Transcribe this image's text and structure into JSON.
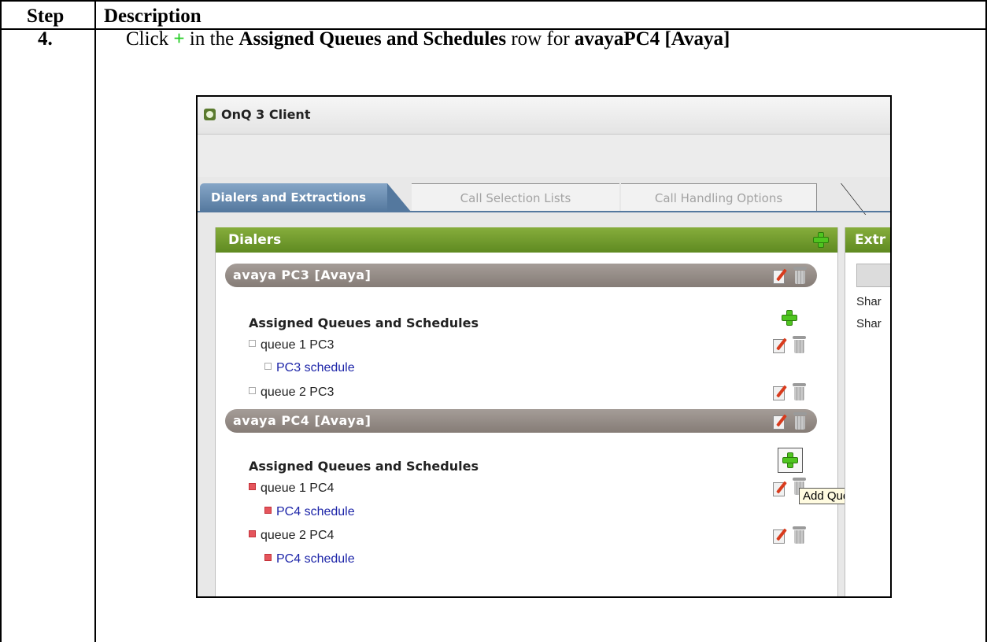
{
  "table": {
    "header_step": "Step",
    "header_description": "Description",
    "step_number": "4.",
    "instruction": {
      "pre": "Click ",
      "plus": "+",
      "mid": " in the ",
      "bold1": "Assigned Queues and Schedules",
      "mid2": " row for ",
      "bold2": "avayaPC4 [Avaya]"
    }
  },
  "window": {
    "title": "OnQ 3 Client"
  },
  "tabs": [
    {
      "label": "Dialers and Extractions",
      "active": true
    },
    {
      "label": "Call Selection Lists",
      "active": false
    },
    {
      "label": "Call Handling Options",
      "active": false
    }
  ],
  "dialers_panel": {
    "title": "Dialers",
    "dialers": [
      {
        "name": "avaya PC3 [Avaya]",
        "section_title": "Assigned Queues and Schedules",
        "queues": [
          {
            "label": "queue 1 PC3",
            "schedule": "PC3 schedule"
          },
          {
            "label": "queue 2 PC3",
            "schedule": ""
          }
        ]
      },
      {
        "name": "avaya PC4 [Avaya]",
        "section_title": "Assigned Queues and Schedules",
        "queues": [
          {
            "label": "queue 1 PC4",
            "schedule": "PC4 schedule"
          },
          {
            "label": "queue 2 PC4",
            "schedule": "PC4 schedule"
          }
        ]
      }
    ],
    "tooltip": "Add Queue"
  },
  "extractions_panel": {
    "title_partial": "Extr",
    "rows": [
      "Shar",
      "Shar"
    ]
  },
  "colors": {
    "panel_header": "#6c9a2a",
    "tab_active": "#54789e",
    "dialer_bar": "#958c86",
    "schedule_text": "#1c24a8",
    "plus_green": "#22cc22"
  }
}
